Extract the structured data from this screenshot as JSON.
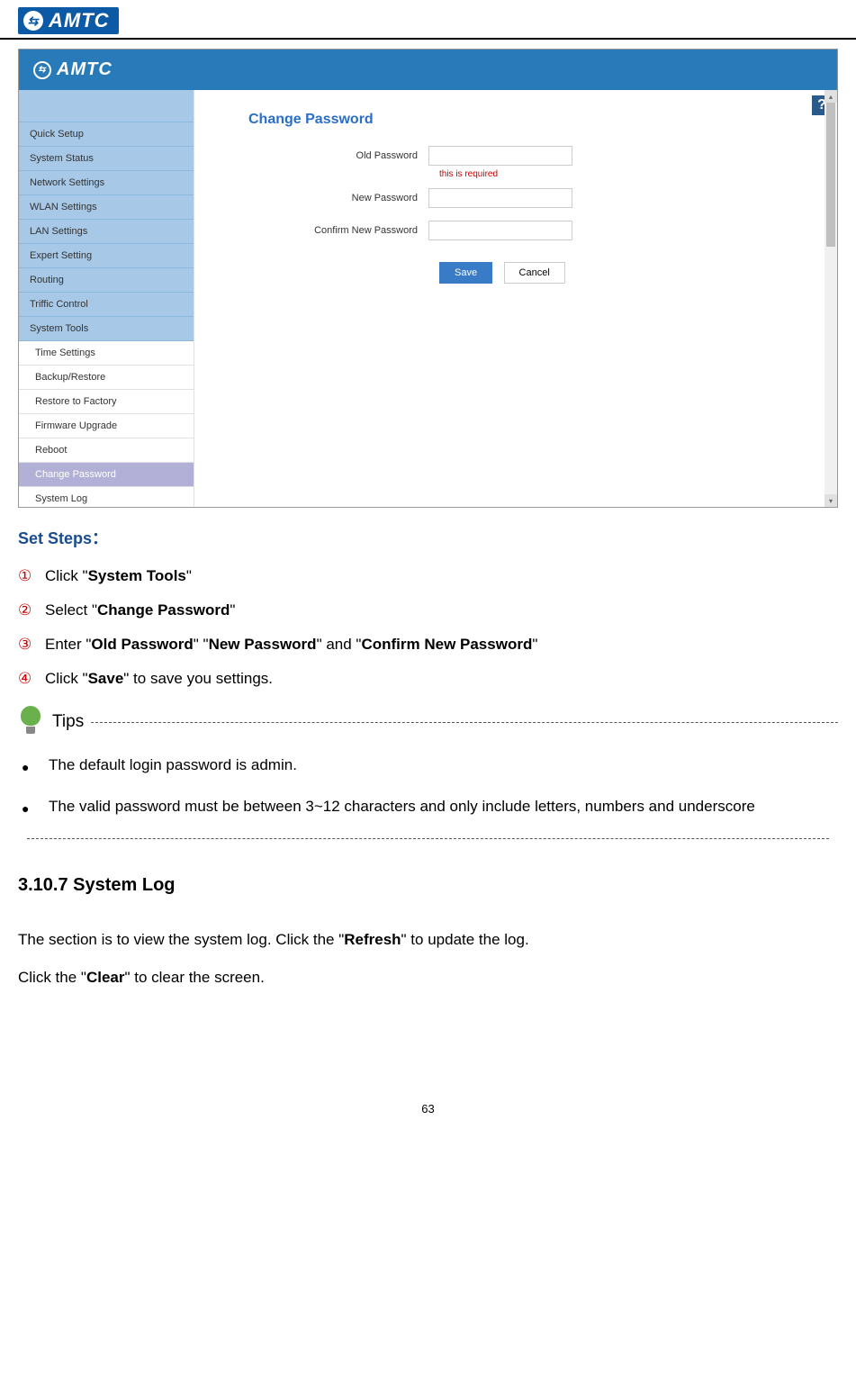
{
  "brand": "AMTC",
  "screenshot": {
    "brand": "AMTC",
    "sidebar": {
      "items": [
        "Quick Setup",
        "System Status",
        "Network Settings",
        "WLAN Settings",
        "LAN Settings",
        "Expert Setting",
        "Routing",
        "Triffic Control",
        "System Tools"
      ],
      "subitems": [
        "Time Settings",
        "Backup/Restore",
        "Restore to Factory",
        "Firmware Upgrade",
        "Reboot",
        "Change Password",
        "System Log"
      ],
      "active_sub": "Change Password"
    },
    "page_title": "Change Password",
    "form": {
      "old_label": "Old Password",
      "old_error": "this is required",
      "new_label": "New Password",
      "confirm_label": "Confirm New Password",
      "save": "Save",
      "cancel": "Cancel"
    },
    "help": "?"
  },
  "doc": {
    "set_steps_title": "Set Steps：",
    "steps": [
      {
        "num": "①",
        "pre": "Click \"",
        "bold": "System Tools",
        "post": "\""
      },
      {
        "num": "②",
        "pre": "Select \"",
        "bold": "Change Password",
        "post": "\""
      },
      {
        "num": "③",
        "text_html": "Enter \"<b>Old Password</b>\" \"<b>New Password</b>\" and \"<b>Confirm New Password</b>\""
      },
      {
        "num": "④",
        "pre": "Click \"",
        "bold": "Save",
        "post": "\" to save you settings."
      }
    ],
    "tips_label": "Tips",
    "tips": [
      "The default login password is admin.",
      "The valid password must be between 3~12 characters and only include letters, numbers and underscore"
    ],
    "subheading": "3.10.7 System Log",
    "para1_html": "The section is to view the system log. Click the \"<b>Refresh</b>\" to update the log.",
    "para2_html": "Click the \"<b>Clear</b>\" to clear the screen.",
    "page_number": "63"
  }
}
